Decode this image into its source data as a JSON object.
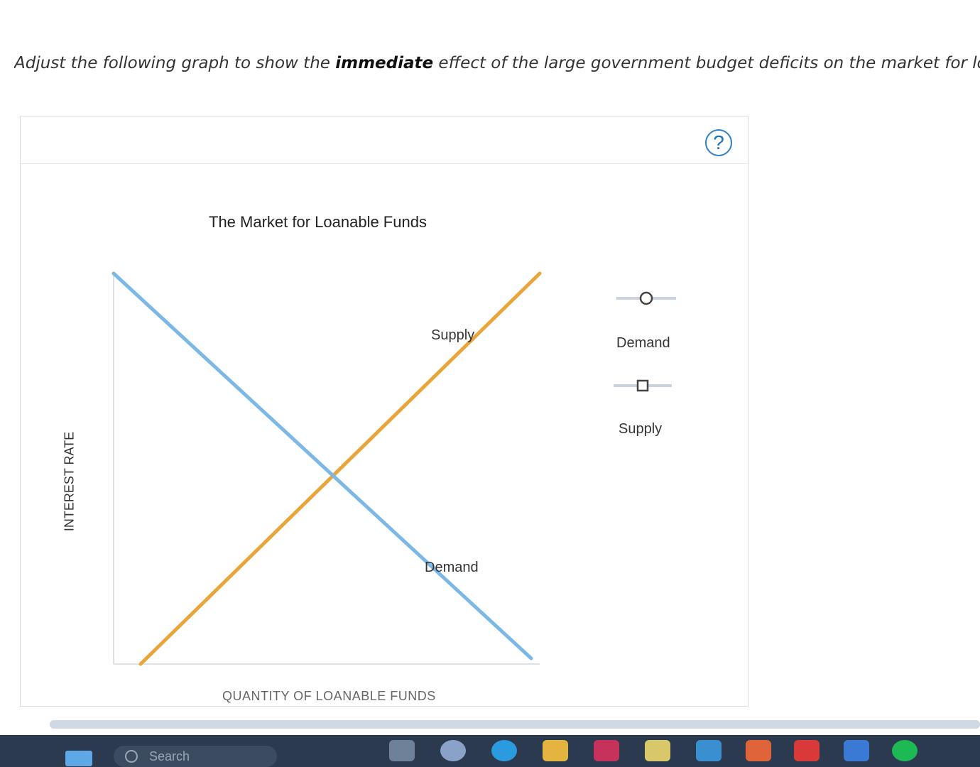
{
  "instruction": {
    "prefix": "Adjust the following graph to show the ",
    "emphasis": "immediate",
    "suffix": " effect of the large government budget deficits on the market for lo"
  },
  "help_label": "?",
  "chart_data": {
    "type": "line",
    "title": "The Market for Loanable Funds",
    "xlabel": "QUANTITY OF LOANABLE FUNDS",
    "ylabel": "INTEREST RATE",
    "series": [
      {
        "name": "Supply",
        "color": "#e8a53a",
        "x": [
          0,
          100
        ],
        "y": [
          0,
          100
        ]
      },
      {
        "name": "Demand",
        "color": "#7cb8e6",
        "x": [
          0,
          100
        ],
        "y": [
          100,
          0
        ]
      }
    ]
  },
  "legend": [
    {
      "label": "Demand",
      "marker": "circle-handle-icon"
    },
    {
      "label": "Supply",
      "marker": "square-handle-icon"
    }
  ],
  "taskbar": {
    "search_placeholder": "Search"
  }
}
